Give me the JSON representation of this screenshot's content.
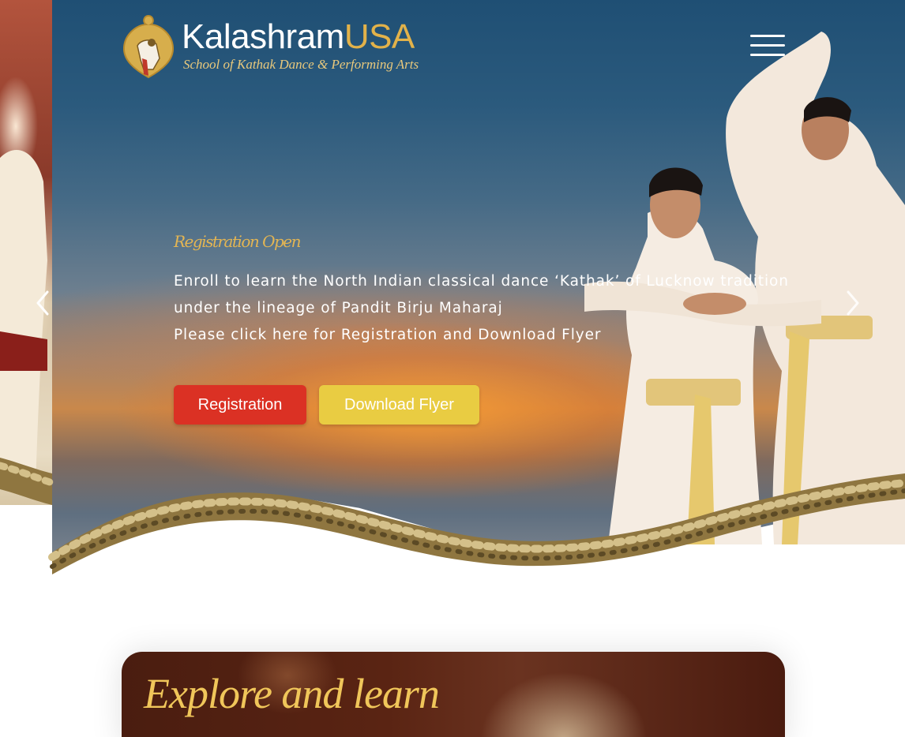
{
  "header": {
    "logo_name_primary": "Kalashram",
    "logo_name_secondary": "USA",
    "logo_tagline": "School of Kathak Dance & Performing Arts",
    "menu_icon": "hamburger-menu-icon"
  },
  "hero": {
    "eyebrow": "Registration Open",
    "description_lines": [
      "Enroll to learn the North Indian classical dance ‘Kathak’ of Lucknow tradition",
      "under the lineage of Pandit Birju Maharaj",
      "Please click here for Registration and Download Flyer"
    ],
    "buttons": {
      "registration": "Registration",
      "download_flyer": "Download Flyer"
    },
    "prev_icon": "chevron-left-icon",
    "next_icon": "chevron-right-icon"
  },
  "explore": {
    "title": "Explore and learn"
  },
  "colors": {
    "brand_gold": "#e2b24a",
    "registration_red": "#db3124",
    "flyer_yellow": "#e9cc42",
    "explore_bg": "#4a1d10"
  }
}
